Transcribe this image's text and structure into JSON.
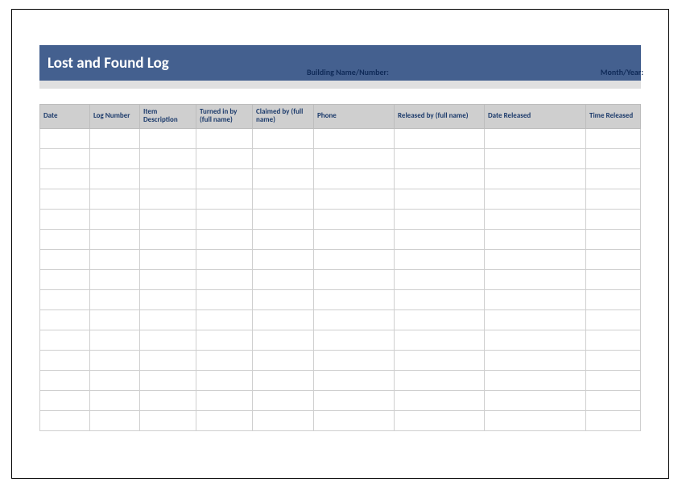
{
  "header": {
    "title": "Lost and Found Log",
    "building_label": "Building Name/Number:",
    "month_label": "Month/Year:"
  },
  "table": {
    "columns": [
      "Date",
      "Log Number",
      "Item Description",
      "Turned in by (full name)",
      "Claimed by (full name)",
      "Phone",
      "Released by (full name)",
      "Date Released",
      "Time Released"
    ],
    "rows": [
      [
        "",
        "",
        "",
        "",
        "",
        "",
        "",
        "",
        ""
      ],
      [
        "",
        "",
        "",
        "",
        "",
        "",
        "",
        "",
        ""
      ],
      [
        "",
        "",
        "",
        "",
        "",
        "",
        "",
        "",
        ""
      ],
      [
        "",
        "",
        "",
        "",
        "",
        "",
        "",
        "",
        ""
      ],
      [
        "",
        "",
        "",
        "",
        "",
        "",
        "",
        "",
        ""
      ],
      [
        "",
        "",
        "",
        "",
        "",
        "",
        "",
        "",
        ""
      ],
      [
        "",
        "",
        "",
        "",
        "",
        "",
        "",
        "",
        ""
      ],
      [
        "",
        "",
        "",
        "",
        "",
        "",
        "",
        "",
        ""
      ],
      [
        "",
        "",
        "",
        "",
        "",
        "",
        "",
        "",
        ""
      ],
      [
        "",
        "",
        "",
        "",
        "",
        "",
        "",
        "",
        ""
      ],
      [
        "",
        "",
        "",
        "",
        "",
        "",
        "",
        "",
        ""
      ],
      [
        "",
        "",
        "",
        "",
        "",
        "",
        "",
        "",
        ""
      ],
      [
        "",
        "",
        "",
        "",
        "",
        "",
        "",
        "",
        ""
      ],
      [
        "",
        "",
        "",
        "",
        "",
        "",
        "",
        "",
        ""
      ],
      [
        "",
        "",
        "",
        "",
        "",
        "",
        "",
        "",
        ""
      ]
    ]
  }
}
